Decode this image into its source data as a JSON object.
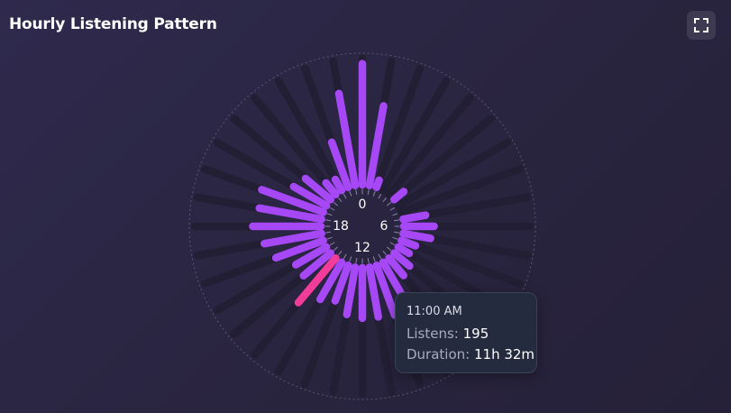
{
  "header": {
    "title": "Hourly Listening Pattern",
    "fullscreen_icon": "expand-icon"
  },
  "colors": {
    "background": "#2b2644",
    "bar": "#a648f5",
    "highlight": "#f23c9a",
    "track": "#221e33",
    "hour_label": "#ffffff"
  },
  "tooltip": {
    "time": "11:00 AM",
    "listens_label": "Listens:",
    "listens_value": "195",
    "duration_label": "Duration:",
    "duration_value": "11h 32m"
  },
  "chart_data": {
    "type": "radial-bar",
    "title": "Hourly Listening Pattern",
    "orientation": "clockwise-from-top",
    "hour_labels": [
      {
        "hour": 0,
        "text": "0"
      },
      {
        "hour": 6,
        "text": "6"
      },
      {
        "hour": 12,
        "text": "12"
      },
      {
        "hour": 18,
        "text": "18"
      }
    ],
    "highlighted_index": 22,
    "bars": [
      {
        "slot": 0,
        "value": 0.96,
        "highlight": false
      },
      {
        "slot": 1,
        "value": 0.64,
        "highlight": false
      },
      {
        "slot": 2,
        "value": 0.06,
        "highlight": false
      },
      {
        "slot": 3,
        "value": 0.0,
        "highlight": false
      },
      {
        "slot": 4,
        "value": 0.0,
        "highlight": false
      },
      {
        "slot": 5,
        "value": 0.1,
        "highlight": false
      },
      {
        "slot": 6,
        "value": 0.0,
        "highlight": false
      },
      {
        "slot": 7,
        "value": 0.0,
        "highlight": false
      },
      {
        "slot": 8,
        "value": 0.18,
        "highlight": false
      },
      {
        "slot": 9,
        "value": 0.24,
        "highlight": false
      },
      {
        "slot": 10,
        "value": 0.22,
        "highlight": false
      },
      {
        "slot": 11,
        "value": 0.12,
        "highlight": false
      },
      {
        "slot": 12,
        "value": 0.1,
        "highlight": false
      },
      {
        "slot": 13,
        "value": 0.16,
        "highlight": false
      },
      {
        "slot": 14,
        "value": 0.18,
        "highlight": false
      },
      {
        "slot": 15,
        "value": 0.36,
        "highlight": false
      },
      {
        "slot": 16,
        "value": 0.42,
        "highlight": false
      },
      {
        "slot": 17,
        "value": 0.4,
        "highlight": false
      },
      {
        "slot": 18,
        "value": 0.4,
        "highlight": false
      },
      {
        "slot": 19,
        "value": 0.38,
        "highlight": false
      },
      {
        "slot": 20,
        "value": 0.3,
        "highlight": false
      },
      {
        "slot": 21,
        "value": 0.34,
        "highlight": false
      },
      {
        "slot": 22,
        "value": 0.46,
        "highlight": true
      },
      {
        "slot": 23,
        "value": 0.28,
        "highlight": false
      },
      {
        "slot": 24,
        "value": 0.28,
        "highlight": false
      },
      {
        "slot": 25,
        "value": 0.4,
        "highlight": false
      },
      {
        "slot": 26,
        "value": 0.46,
        "highlight": false
      },
      {
        "slot": 27,
        "value": 0.54,
        "highlight": false
      },
      {
        "slot": 28,
        "value": 0.5,
        "highlight": false
      },
      {
        "slot": 29,
        "value": 0.52,
        "highlight": false
      },
      {
        "slot": 30,
        "value": 0.3,
        "highlight": false
      },
      {
        "slot": 31,
        "value": 0.26,
        "highlight": false
      },
      {
        "slot": 32,
        "value": 0.12,
        "highlight": false
      },
      {
        "slot": 33,
        "value": 0.1,
        "highlight": false
      },
      {
        "slot": 34,
        "value": 0.38,
        "highlight": false
      },
      {
        "slot": 35,
        "value": 0.74,
        "highlight": false
      }
    ]
  }
}
